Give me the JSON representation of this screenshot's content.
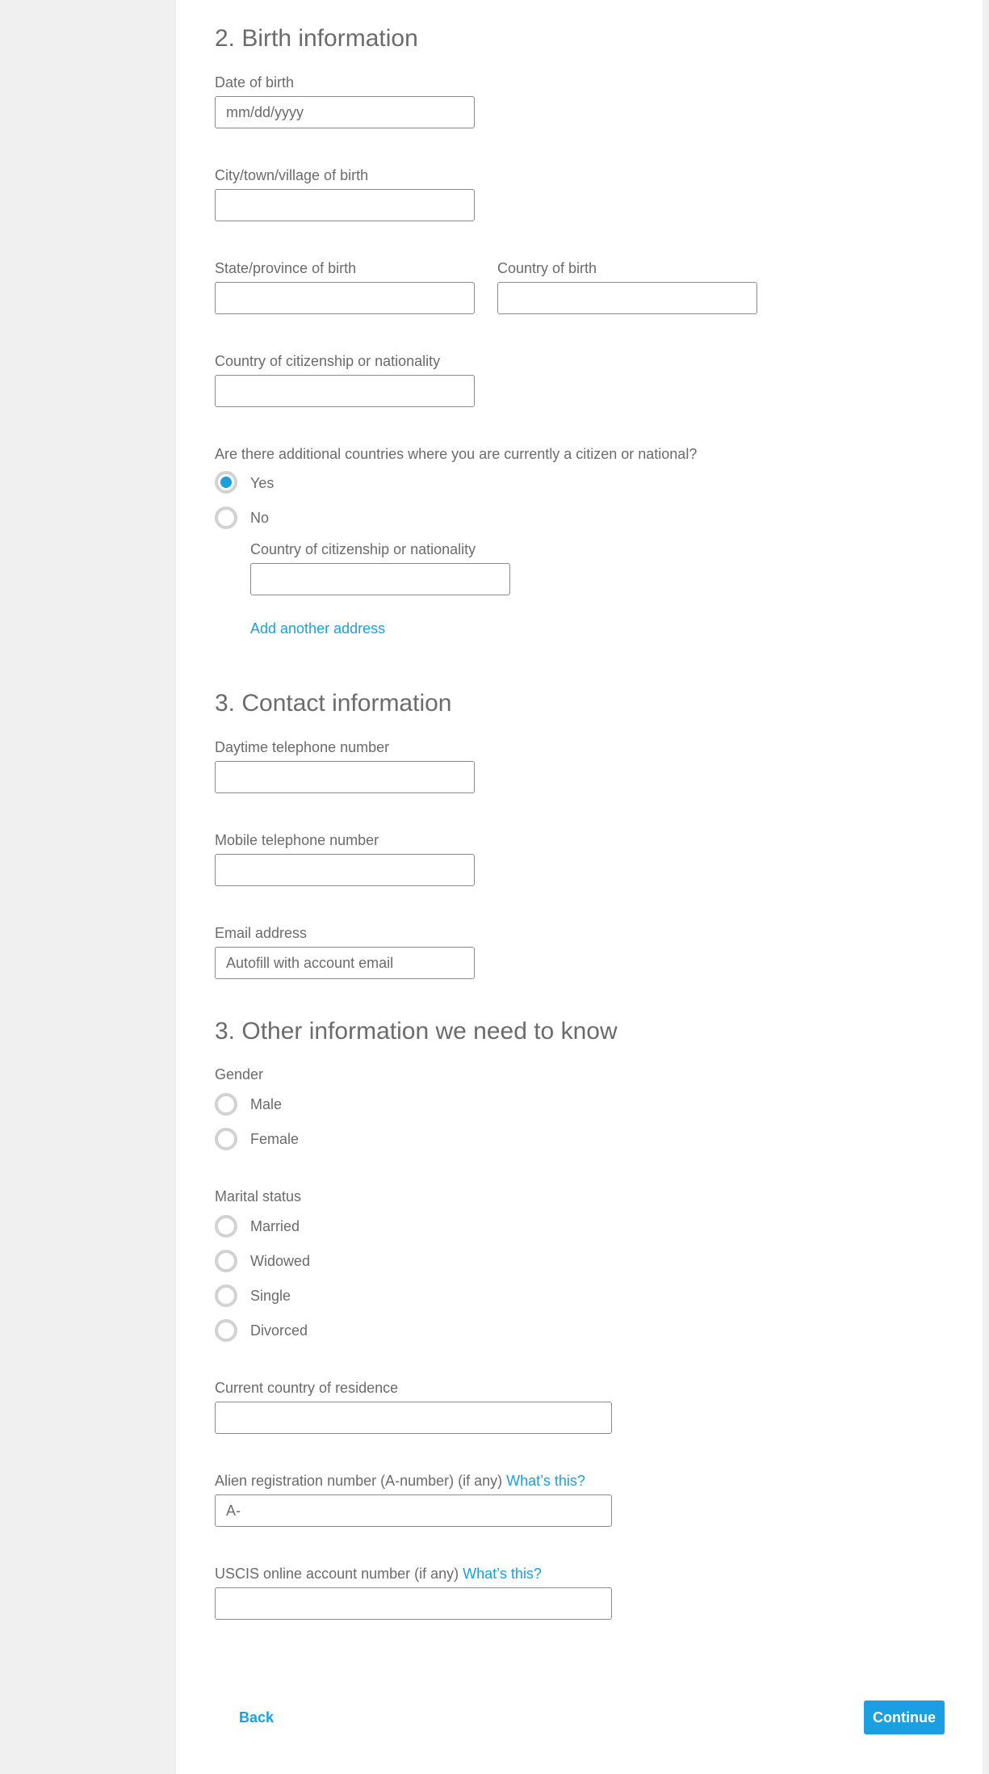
{
  "birth": {
    "heading": "2. Birth information",
    "dob_label": "Date of birth",
    "dob_placeholder": "mm/dd/yyyy",
    "city_label": "City/town/village of birth",
    "state_label": "State/province of birth",
    "country_label": "Country of birth",
    "citizenship_label": "Country of citizenship or nationality",
    "additional_question": "Are there additional countries where you are currently a citizen or national?",
    "yes_label": "Yes",
    "no_label": "No",
    "additional_citizenship_label": "Country of citizenship or nationality",
    "add_another_label": "Add another address"
  },
  "contact": {
    "heading": "3. Contact information",
    "daytime_label": "Daytime telephone number",
    "mobile_label": "Mobile telephone number",
    "email_label": "Email address",
    "email_placeholder": "Autofill with account email"
  },
  "other": {
    "heading": "3. Other information we need to know",
    "gender_label": "Gender",
    "gender_options": [
      "Male",
      "Female"
    ],
    "marital_label": "Marital status",
    "marital_options": [
      "Married",
      "Widowed",
      "Single",
      "Divorced"
    ],
    "residence_label": "Current country of residence",
    "anumber_label": "Alien registration number (A-number) (if any)",
    "anumber_link": "What’s this?",
    "anumber_placeholder": "A-",
    "uscis_label": "USCIS online account number (if any)",
    "uscis_link": "What’s this?"
  },
  "nav": {
    "back_label": "Back",
    "continue_label": "Continue"
  },
  "colors": {
    "accent": "#1a9fe0",
    "text": "#6b6b6b",
    "background": "#f0f0f0"
  }
}
